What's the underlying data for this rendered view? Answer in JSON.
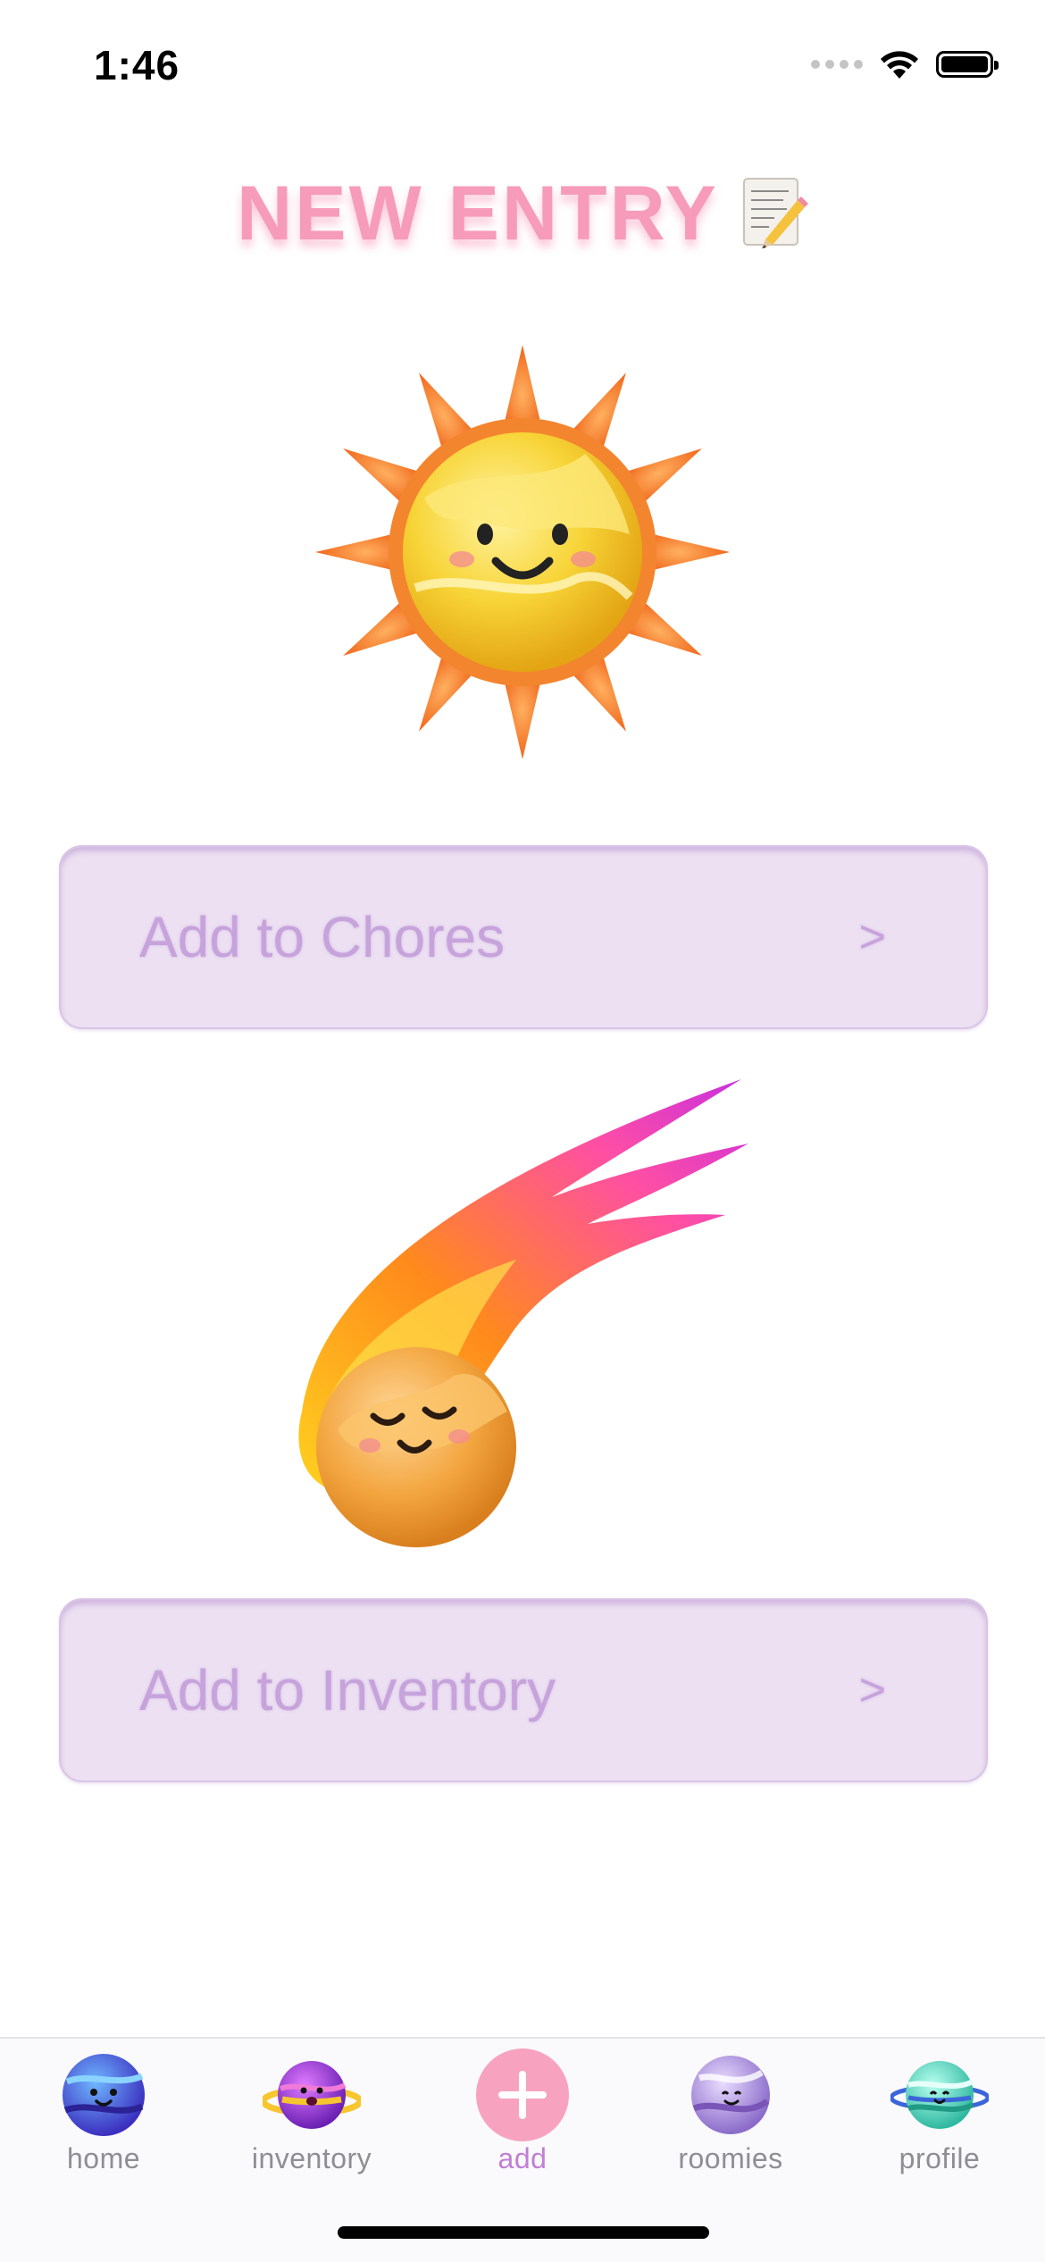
{
  "status_bar": {
    "time": "1:46",
    "icons": [
      "cellular-dots-icon",
      "wifi-icon",
      "battery-icon"
    ]
  },
  "header": {
    "title": "NEW ENTRY",
    "title_icon": "memo-pencil-icon",
    "title_color": "#f79bbb"
  },
  "illustrations": {
    "top": "smiling-sun-icon",
    "middle": "smiling-meteor-icon"
  },
  "actions": {
    "chores_label": "Add to Chores",
    "chores_chevron": ">",
    "inventory_label": "Add to Inventory",
    "inventory_chevron": ">"
  },
  "tab_bar": {
    "items": [
      {
        "label": "home",
        "icon": "blue-planet-icon"
      },
      {
        "label": "inventory",
        "icon": "ringed-purple-planet-icon"
      },
      {
        "label": "add",
        "icon": "plus-circle-icon"
      },
      {
        "label": "roomies",
        "icon": "lavender-planet-icon"
      },
      {
        "label": "profile",
        "icon": "teal-ringed-planet-icon"
      }
    ],
    "active": "add",
    "active_color": "#c17fd6"
  },
  "colors": {
    "button_background": "#ece0f2",
    "button_text": "#c7a3dc",
    "add_button": "#f7a3c0"
  }
}
